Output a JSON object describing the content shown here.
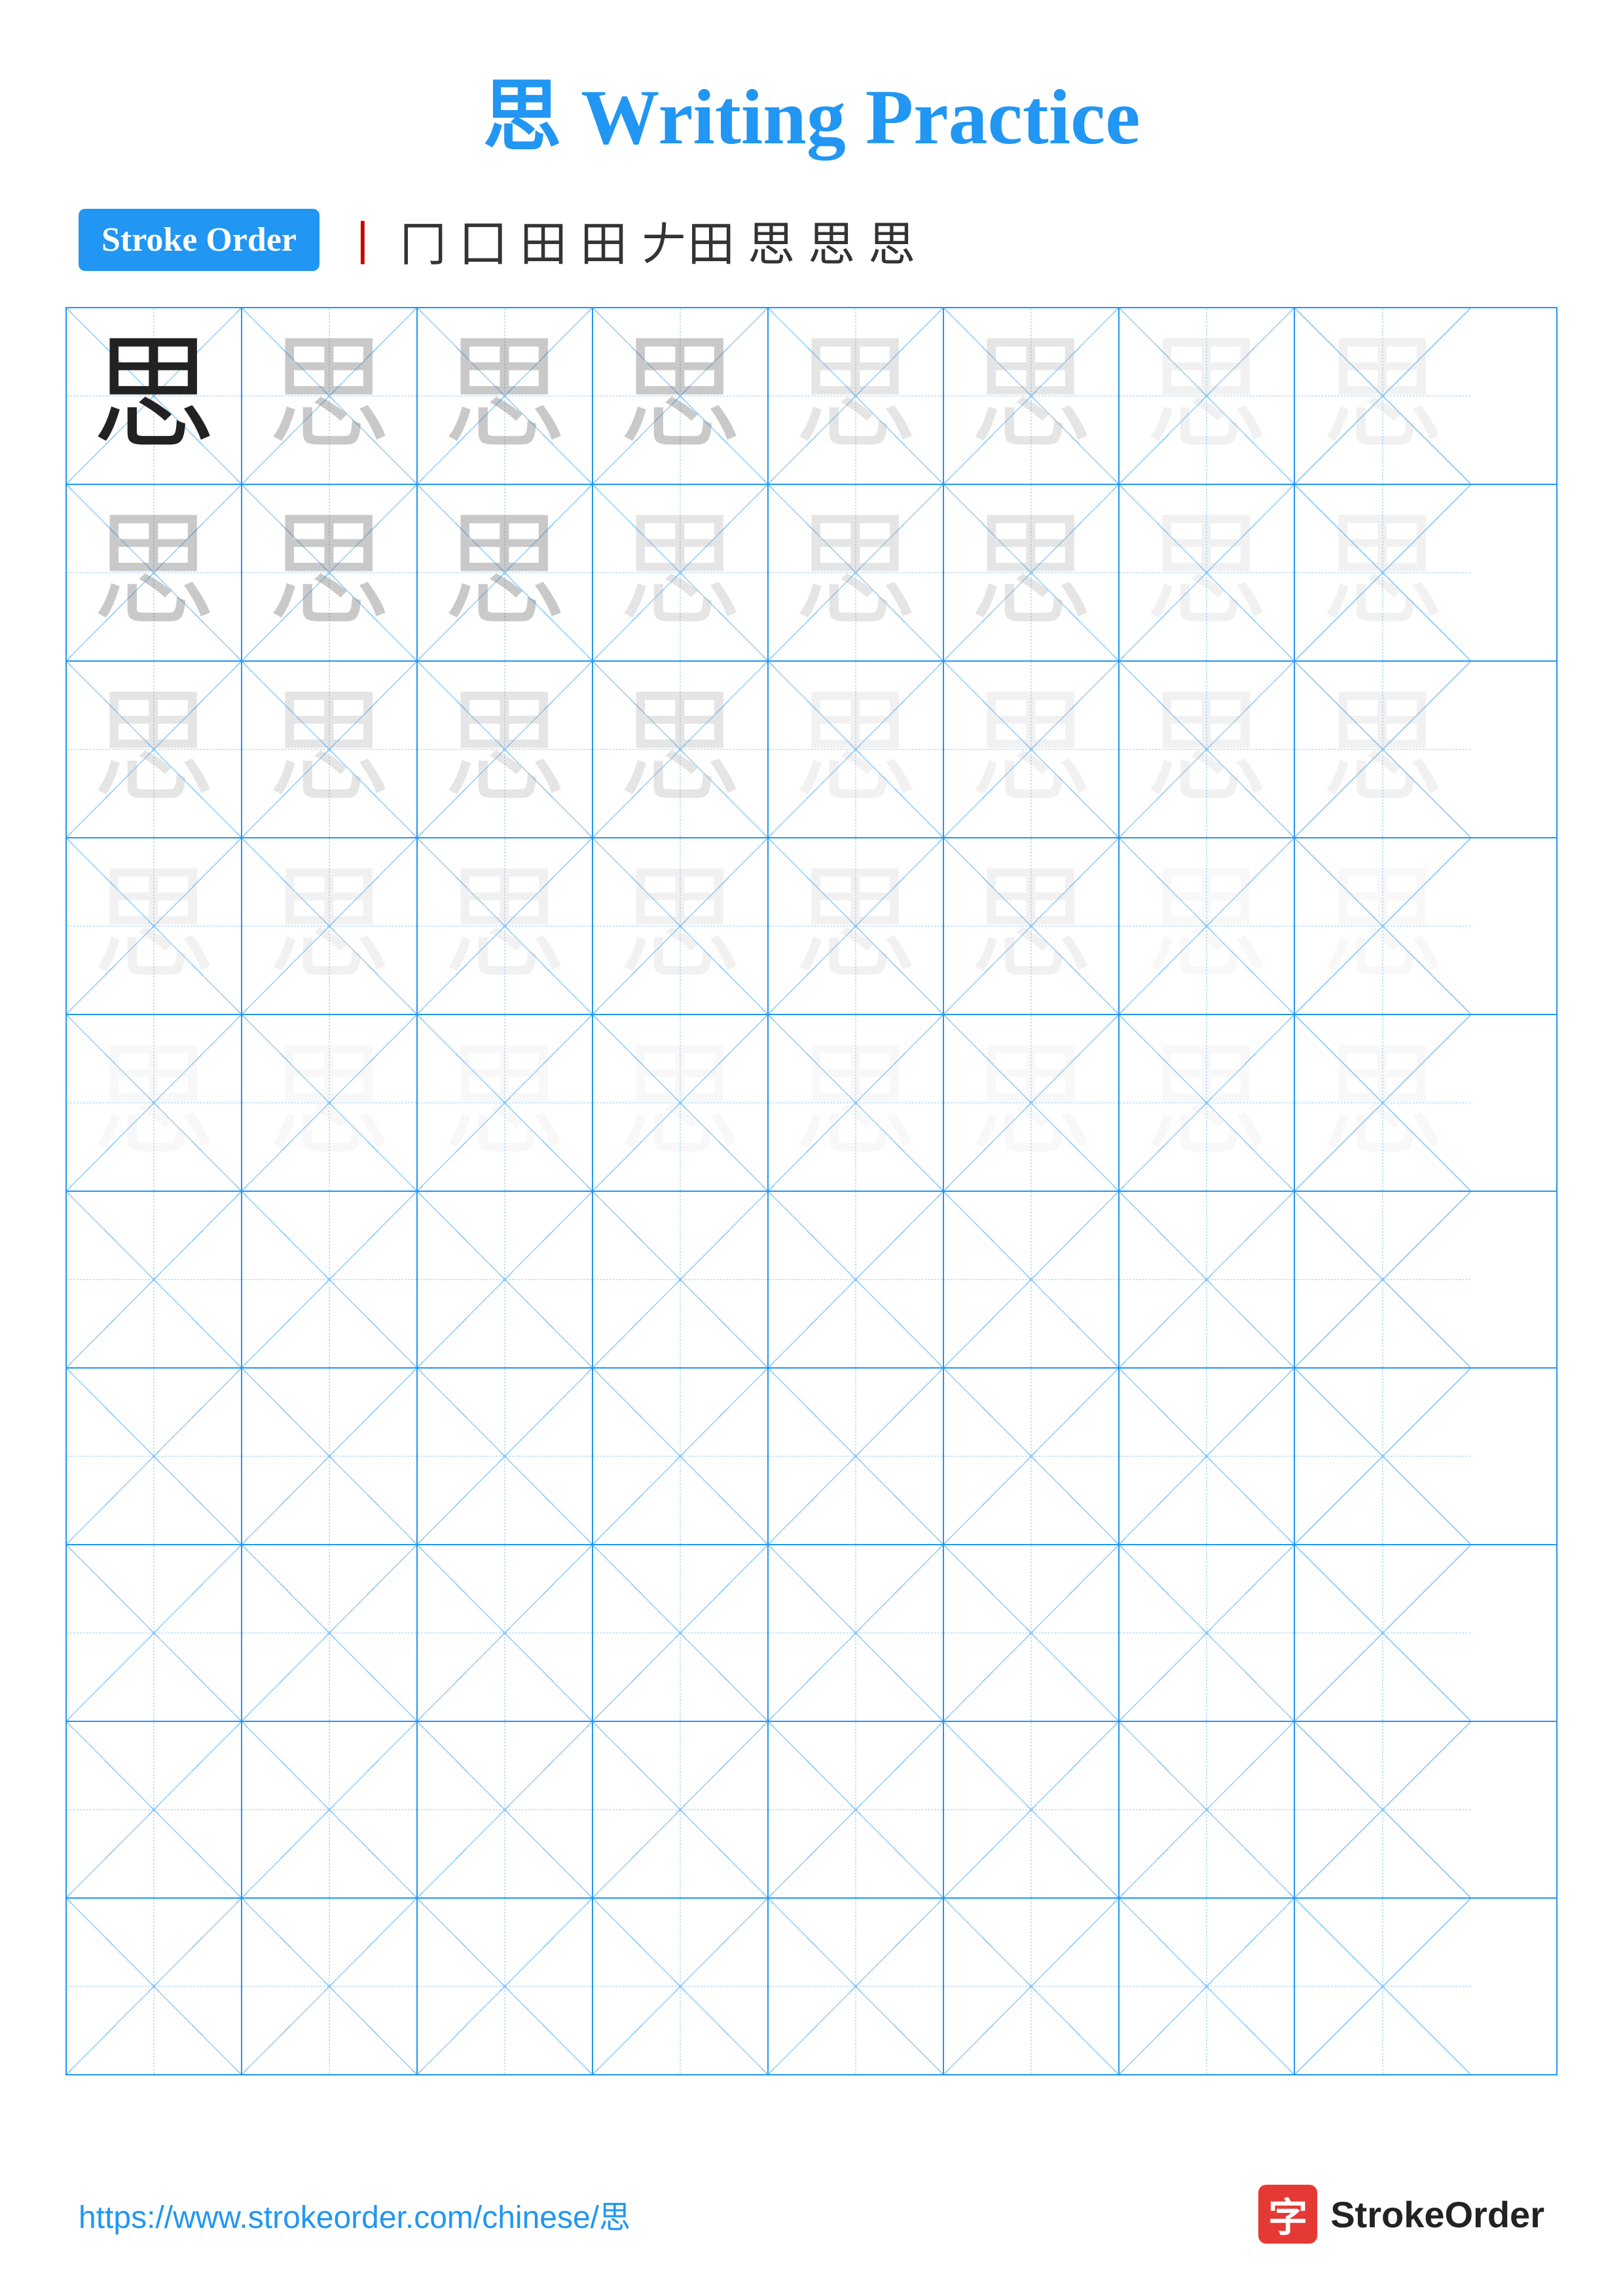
{
  "title": "思 Writing Practice",
  "stroke_order": {
    "badge_label": "Stroke Order",
    "sequence": [
      "丨",
      "冂",
      "囗",
      "田",
      "田",
      "丨田",
      "思",
      "思",
      "思"
    ]
  },
  "character": "思",
  "grid": {
    "rows": 10,
    "cols": 8
  },
  "footer": {
    "url": "https://www.strokeorder.com/chinese/思",
    "logo_char": "字",
    "logo_text": "StrokeOrder"
  }
}
